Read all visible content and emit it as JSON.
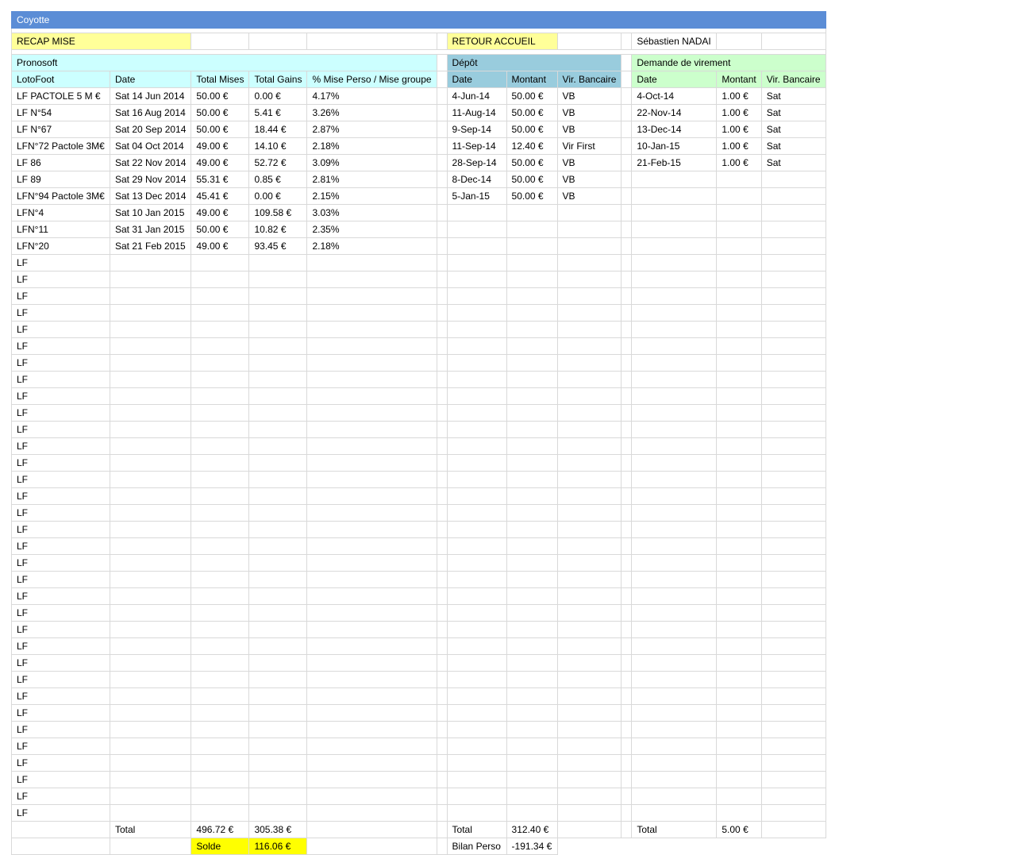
{
  "title": "Coyotte",
  "nav": {
    "recap_mise": "RECAP MISE",
    "retour_accueil": "RETOUR ACCUEIL",
    "user_name": "Sébastien NADAI"
  },
  "sections": {
    "pronosoft": "Pronosoft",
    "depot": "Dépôt",
    "virement": "Demande de virement"
  },
  "headers": {
    "pronosoft": [
      "LotoFoot",
      "Date",
      "Total Mises",
      "Total Gains",
      "% Mise Perso / Mise groupe"
    ],
    "depot": [
      "Date",
      "Montant",
      "Vir. Bancaire"
    ],
    "virement": [
      "Date",
      "Montant",
      "Vir. Bancaire"
    ]
  },
  "pronosoft_rows": [
    [
      "LF PACTOLE 5 M €",
      "Sat 14 Jun 2014",
      "50.00 €",
      "0.00 €",
      "4.17%"
    ],
    [
      "LF N°54",
      "Sat 16 Aug 2014",
      "50.00 €",
      "5.41 €",
      "3.26%"
    ],
    [
      "LF N°67",
      "Sat 20 Sep 2014",
      "50.00 €",
      "18.44 €",
      "2.87%"
    ],
    [
      "LFN°72 Pactole 3M€",
      "Sat 04 Oct 2014",
      "49.00 €",
      "14.10 €",
      "2.18%"
    ],
    [
      "LF 86",
      "Sat 22 Nov 2014",
      "49.00 €",
      "52.72 €",
      "3.09%"
    ],
    [
      "LF 89",
      "Sat 29 Nov 2014",
      "55.31 €",
      "0.85 €",
      "2.81%"
    ],
    [
      "LFN°94 Pactole 3M€",
      "Sat 13 Dec 2014",
      "45.41 €",
      "0.00 €",
      "2.15%"
    ],
    [
      "LFN°4",
      "Sat 10 Jan 2015",
      "49.00 €",
      "109.58 €",
      "3.03%"
    ],
    [
      "LFN°11",
      "Sat 31 Jan 2015",
      "50.00 €",
      "10.82 €",
      "2.35%"
    ],
    [
      "LFN°20",
      "Sat 21 Feb 2015",
      "49.00 €",
      "93.45 €",
      "2.18%"
    ],
    [
      "LF",
      "",
      "",
      "",
      ""
    ],
    [
      "LF",
      "",
      "",
      "",
      ""
    ],
    [
      "LF",
      "",
      "",
      "",
      ""
    ],
    [
      "LF",
      "",
      "",
      "",
      ""
    ],
    [
      "LF",
      "",
      "",
      "",
      ""
    ],
    [
      "LF",
      "",
      "",
      "",
      ""
    ],
    [
      "LF",
      "",
      "",
      "",
      ""
    ],
    [
      "LF",
      "",
      "",
      "",
      ""
    ],
    [
      "LF",
      "",
      "",
      "",
      ""
    ],
    [
      "LF",
      "",
      "",
      "",
      ""
    ],
    [
      "LF",
      "",
      "",
      "",
      ""
    ],
    [
      "LF",
      "",
      "",
      "",
      ""
    ],
    [
      "LF",
      "",
      "",
      "",
      ""
    ],
    [
      "LF",
      "",
      "",
      "",
      ""
    ],
    [
      "LF",
      "",
      "",
      "",
      ""
    ],
    [
      "LF",
      "",
      "",
      "",
      ""
    ],
    [
      "LF",
      "",
      "",
      "",
      ""
    ],
    [
      "LF",
      "",
      "",
      "",
      ""
    ],
    [
      "LF",
      "",
      "",
      "",
      ""
    ],
    [
      "LF",
      "",
      "",
      "",
      ""
    ],
    [
      "LF",
      "",
      "",
      "",
      ""
    ],
    [
      "LF",
      "",
      "",
      "",
      ""
    ],
    [
      "LF",
      "",
      "",
      "",
      ""
    ],
    [
      "LF",
      "",
      "",
      "",
      ""
    ],
    [
      "LF",
      "",
      "",
      "",
      ""
    ],
    [
      "LF",
      "",
      "",
      "",
      ""
    ],
    [
      "LF",
      "",
      "",
      "",
      ""
    ],
    [
      "LF",
      "",
      "",
      "",
      ""
    ],
    [
      "LF",
      "",
      "",
      "",
      ""
    ],
    [
      "LF",
      "",
      "",
      "",
      ""
    ],
    [
      "LF",
      "",
      "",
      "",
      ""
    ],
    [
      "LF",
      "",
      "",
      "",
      ""
    ],
    [
      "LF",
      "",
      "",
      "",
      ""
    ],
    [
      "LF",
      "",
      "",
      "",
      ""
    ]
  ],
  "depot_rows": [
    [
      "4-Jun-14",
      "50.00 €",
      "VB"
    ],
    [
      "11-Aug-14",
      "50.00 €",
      "VB"
    ],
    [
      "9-Sep-14",
      "50.00 €",
      "VB"
    ],
    [
      "11-Sep-14",
      "12.40 €",
      "Vir First"
    ],
    [
      "28-Sep-14",
      "50.00 €",
      "VB"
    ],
    [
      "8-Dec-14",
      "50.00 €",
      "VB"
    ],
    [
      "5-Jan-15",
      "50.00 €",
      "VB"
    ]
  ],
  "virement_rows": [
    [
      "4-Oct-14",
      "1.00 €",
      "Sat"
    ],
    [
      "22-Nov-14",
      "1.00 €",
      "Sat"
    ],
    [
      "13-Dec-14",
      "1.00 €",
      "Sat"
    ],
    [
      "10-Jan-15",
      "1.00 €",
      "Sat"
    ],
    [
      "21-Feb-15",
      "1.00 €",
      "Sat"
    ]
  ],
  "totals": {
    "pronosoft": {
      "label": "Total",
      "mises": "496.72 €",
      "gains": "305.38 €",
      "solde_label": "Solde",
      "solde": "116.06 €"
    },
    "depot": {
      "label": "Total",
      "montant": "312.40 €",
      "bilan_label": "Bilan Perso",
      "bilan": "-191.34 €"
    },
    "virement": {
      "label": "Total",
      "montant": "5.00 €"
    }
  },
  "colors": {
    "title_bar": "#5b8dd6",
    "nav_yellow": "#ffff99",
    "pronosoft_header": "#ccffff",
    "depot_header": "#99ccdd",
    "virement_header": "#ccffcc",
    "highlight": "#ffff00",
    "grid": "#d9d9d9"
  }
}
